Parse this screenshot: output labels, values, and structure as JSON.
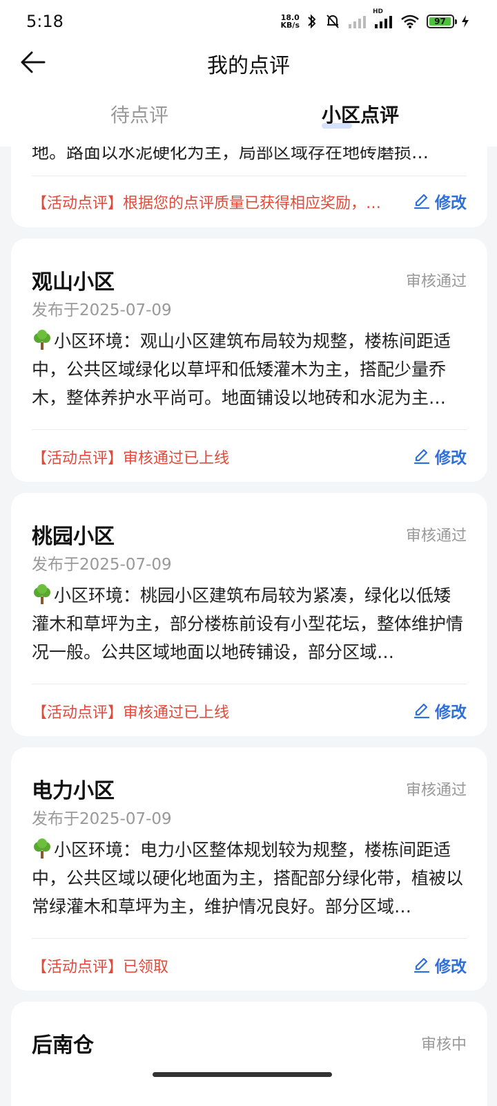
{
  "status_bar": {
    "time": "5:18",
    "net_speed_value": "18.0",
    "net_speed_unit": "KB/s",
    "signal_label": "HD",
    "battery_percent": "97",
    "battery_level": 0.97
  },
  "header": {
    "title": "我的点评",
    "tabs": [
      {
        "label": "待点评",
        "active": false
      },
      {
        "label": "小区点评",
        "active": true
      }
    ]
  },
  "reviews": [
    {
      "body_tail": "地。路面以水泥硬化为主，局部区域存在地砖磨损…",
      "activity": "【活动点评】根据您的点评质量已获得相应奖励，…",
      "edit_label": "修改"
    },
    {
      "name": "观山小区",
      "status": "审核通过",
      "date": "发布于2025-07-09",
      "body": "小区环境：观山小区建筑布局较为规整，楼栋间距适中，公共区域绿化以草坪和低矮灌木为主，搭配少量乔木，整体养护水平尚可。地面铺设以地砖和水泥为主…",
      "activity": "【活动点评】审核通过已上线",
      "edit_label": "修改"
    },
    {
      "name": "桃园小区",
      "status": "审核通过",
      "date": "发布于2025-07-09",
      "body": "小区环境：桃园小区建筑布局较为紧凑，绿化以低矮灌木和草坪为主，部分楼栋前设有小型花坛，整体维护情况一般。公共区域地面以地砖铺设，部分区域…",
      "activity": "【活动点评】审核通过已上线",
      "edit_label": "修改"
    },
    {
      "name": "电力小区",
      "status": "审核通过",
      "date": "发布于2025-07-09",
      "body": "小区环境：电力小区整体规划较为规整，楼栋间距适中，公共区域以硬化地面为主，搭配部分绿化带，植被以常绿灌木和草坪为主，维护情况良好。部分区域…",
      "activity": "【活动点评】已领取",
      "edit_label": "修改"
    },
    {
      "name": "后南仓",
      "status": "审核中"
    }
  ],
  "colors": {
    "accent_blue": "#2f6fdc",
    "activity_red": "#e24a3b",
    "muted": "#999999"
  }
}
